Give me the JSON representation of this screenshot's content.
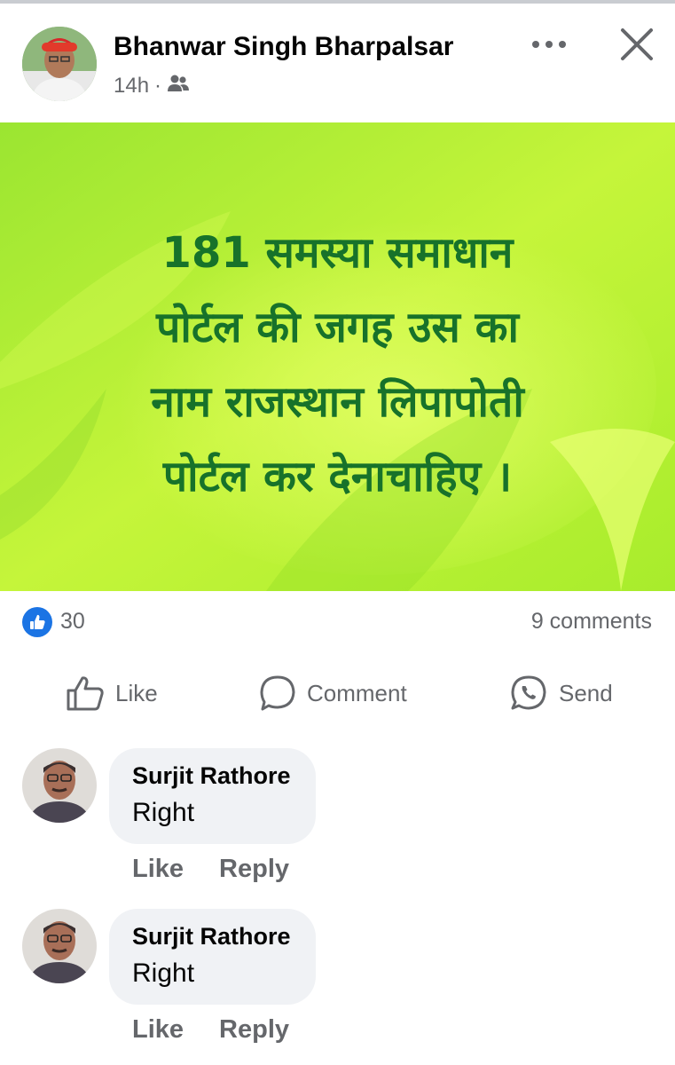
{
  "post": {
    "author": "Bhanwar Singh Bharpalsar",
    "time": "14h",
    "separator": "·",
    "audience_icon": "friends-icon",
    "more_icon": "more-options-icon",
    "close_icon": "close-icon",
    "image_text_lines": [
      "181 समस्या समाधान",
      "पोर्टल  की जगह उस का",
      "नाम राजस्थान लिपापोती",
      "पोर्टल कर देनाचाहिए ।"
    ]
  },
  "stats": {
    "reaction_count": "30",
    "comments": "9 comments"
  },
  "actions": {
    "like": "Like",
    "comment": "Comment",
    "send": "Send"
  },
  "comments": [
    {
      "author": "Surjit Rathore",
      "text": "Right",
      "like": "Like",
      "reply": "Reply"
    },
    {
      "author": "Surjit Rathore",
      "text": "Right",
      "like": "Like",
      "reply": "Reply"
    }
  ],
  "colors": {
    "accent": "#1b74e4",
    "secondary_text": "#65676b",
    "bubble": "#f0f2f5",
    "image_text": "#17722a",
    "image_bg": "#b6f02c"
  }
}
